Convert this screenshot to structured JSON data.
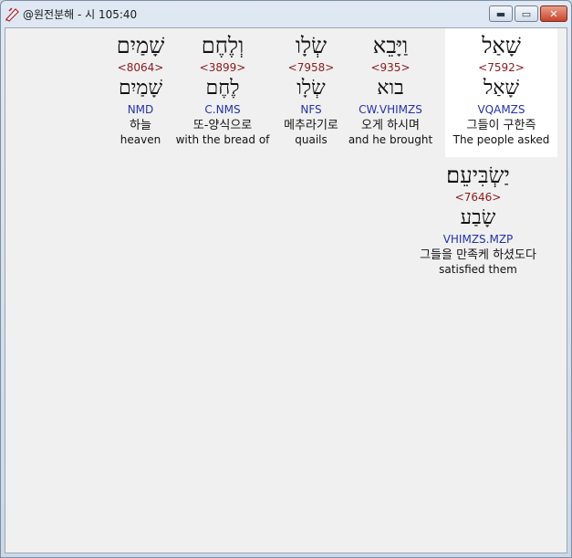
{
  "window": {
    "title": "@원전분해 - 시 105:40"
  },
  "words": [
    {
      "hebrew": "שָׁאַל",
      "strong": "<7592>",
      "root": "שָׁאַל",
      "morph": "VQAMZS",
      "korean": "그들이 구한즉",
      "english": "The people asked"
    },
    {
      "hebrew": "וַיָּבֵא",
      "strong": "<935>",
      "root": "בוא",
      "morph": "CW.VHIMZS",
      "korean": "오게 하시며",
      "english": "and he brought"
    },
    {
      "hebrew": "שְׂלָו",
      "strong": "<7958>",
      "root": "שְׂלָו",
      "morph": "NFS",
      "korean": "메추라기로",
      "english": "quails"
    },
    {
      "hebrew": "וְלֶחֶם",
      "strong": "<3899>",
      "root": "לֶחֶם",
      "morph": "C.NMS",
      "korean": "또-양식으로",
      "english": "with the bread of"
    },
    {
      "hebrew": "שָׁמַיִם",
      "strong": "<8064>",
      "root": "שָׁמַיִם",
      "morph": "NMD",
      "korean": "하늘",
      "english": "heaven"
    },
    {
      "hebrew": "יַשְׂבִּיעֵם׃",
      "strong": "<7646>",
      "root": "שָׂבַע",
      "morph": "VHIMZS.MZP",
      "korean": "그들을 만족케 하셨도다",
      "english": "satisfied them"
    }
  ]
}
